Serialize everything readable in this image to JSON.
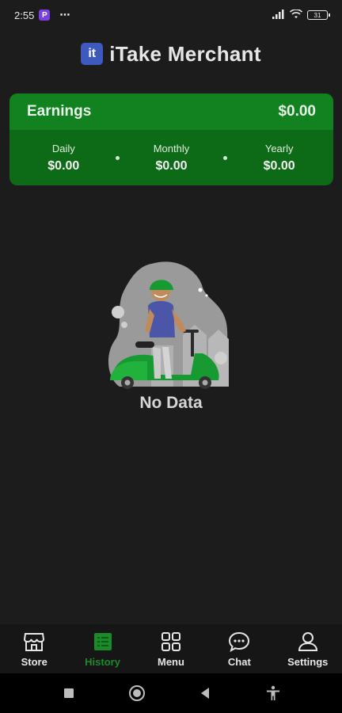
{
  "status_bar": {
    "time": "2:55",
    "notification_app": "P",
    "more": "⋯",
    "battery": "31"
  },
  "header": {
    "logo_text": "it",
    "title": "iTake Merchant"
  },
  "earnings": {
    "label": "Earnings",
    "total": "$0.00",
    "periods": [
      {
        "label": "Daily",
        "value": "$0.00"
      },
      {
        "label": "Monthly",
        "value": "$0.00"
      },
      {
        "label": "Yearly",
        "value": "$0.00"
      }
    ]
  },
  "empty_state": {
    "message": "No Data"
  },
  "bottom_nav": {
    "items": [
      {
        "label": "Store",
        "icon": "store-icon"
      },
      {
        "label": "History",
        "icon": "history-icon",
        "active": true
      },
      {
        "label": "Menu",
        "icon": "menu-grid-icon"
      },
      {
        "label": "Chat",
        "icon": "chat-icon"
      },
      {
        "label": "Settings",
        "icon": "user-icon"
      }
    ]
  },
  "colors": {
    "background": "#1c1c1c",
    "card_green": "#0d6b18",
    "card_green_top": "#128221",
    "active_nav": "#1a8a2a",
    "logo_blue": "#3d5bbf"
  }
}
